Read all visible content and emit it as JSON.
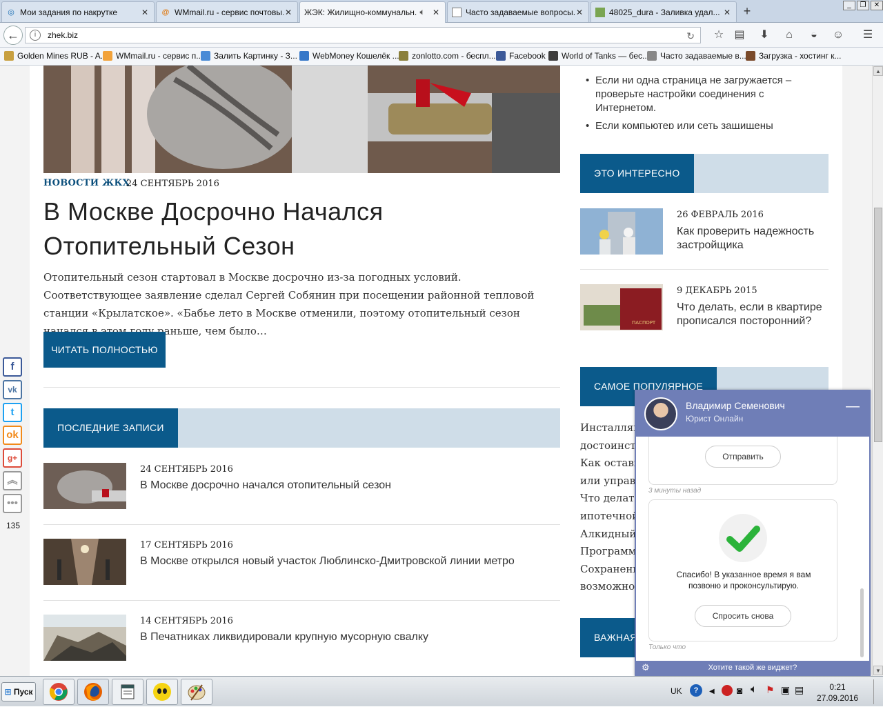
{
  "tabs": [
    {
      "title": "Мои задания по накрутке",
      "icon": "swirl-icon",
      "active": false
    },
    {
      "title": "WMmail.ru - сервис почтовы...",
      "icon": "at-icon",
      "active": false
    },
    {
      "title": "ЖЭК: Жилищно-коммунальн...",
      "icon": "none",
      "active": true
    },
    {
      "title": "Часто задаваемые вопросы...",
      "icon": "page-icon",
      "active": false
    },
    {
      "title": "48025_dura - Заливка удал...",
      "icon": "image-icon",
      "active": false
    }
  ],
  "address": {
    "url": "zhek.biz"
  },
  "bookmarks": [
    {
      "label": "Golden Mines RUB - A...",
      "color": "#c8a040"
    },
    {
      "label": "WMmail.ru - сервис п...",
      "color": "#f2a23a"
    },
    {
      "label": "Залить Картинку - З...",
      "color": "#4a8bd6"
    },
    {
      "label": "WebMoney Кошелёк ...",
      "color": "#3577c8"
    },
    {
      "label": "zonlotto.com - беспл...",
      "color": "#8a7f3a"
    },
    {
      "label": "Facebook",
      "color": "#3b5998"
    },
    {
      "label": "World of Tanks — бес...",
      "color": "#3c3c3c"
    },
    {
      "label": "Часто задаваемые в...",
      "color": "#888888"
    },
    {
      "label": "Загрузка - хостинг к...",
      "color": "#7a4a2a"
    }
  ],
  "article": {
    "category": "НОВОСТИ ЖКХ",
    "date": "24 СЕНТЯБРЬ 2016",
    "title_line1": "В Москве Досрочно Начался",
    "title_line2": "Отопительный Сезон",
    "excerpt": "Отопительный сезон стартовал в Москве досрочно из-за погодных условий. Соответствующее заявление сделал Сергей Собянин при посещении районной тепловой станции «Крылатское». «Бабье лето в Москве отменили, поэтому отопительный сезон начался в этом году раньше, чем было…",
    "read_more": "ЧИТАТЬ ПОЛНОСТЬЮ"
  },
  "recent": {
    "heading": "ПОСЛЕДНИЕ ЗАПИСИ",
    "posts": [
      {
        "date": "24 СЕНТЯБРЬ 2016",
        "title": "В Москве досрочно начался отопительный сезон"
      },
      {
        "date": "17 СЕНТЯБРЬ 2016",
        "title": "В Москве открылся новый участок Люблинско-Дмитровской линии метро"
      },
      {
        "date": "14 СЕНТЯБРЬ 2016",
        "title": "В Печатниках ликвидировали крупную мусорную свалку"
      }
    ]
  },
  "sidebar": {
    "error_items": [
      "Если ни одна страница не загружается – проверьте настройки соединения с Интернетом.",
      "Если компьютер или сеть защищены"
    ],
    "interesting_heading": "ЭТО ИНТЕРЕСНО",
    "interesting": [
      {
        "date": "26 ФЕВРАЛЬ 2016",
        "title": "Как проверить надежность застройщика"
      },
      {
        "date": "9 ДЕКАБРЬ 2015",
        "title": "Что делать, если в квартире прописался посторонний?"
      }
    ],
    "popular_heading": "САМОЕ ПОПУЛЯРНОЕ",
    "popular": [
      "Инсталляц",
      "достоинств",
      "Как остави",
      "или управл",
      "Что делать",
      "ипотечной",
      "Алкидный",
      "Программа",
      "Сохранени",
      "возможност"
    ],
    "important_heading": "ВАЖНАЯ"
  },
  "share": {
    "count": "135"
  },
  "chat": {
    "name": "Владимир Семенович",
    "role": "Юрист Онлайн",
    "send_button": "Отправить",
    "time_ago": "3 минуты назад",
    "thanks": "Спасибо! В указанное время я вам позвоню и проконсультирую.",
    "ask_again": "Спросить снова",
    "just_now": "Только что",
    "footer": "Хотите такой же виджет?"
  },
  "taskbar": {
    "start": "Пуск",
    "lang": "UK",
    "time": "0:21",
    "date": "27.09.2016"
  }
}
